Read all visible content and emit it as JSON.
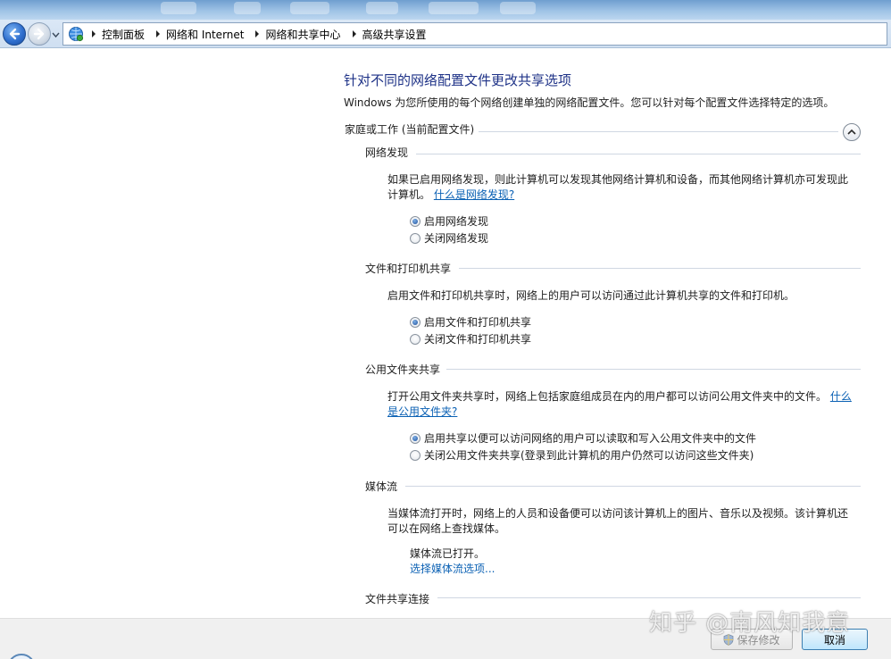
{
  "breadcrumb": [
    "控制面板",
    "网络和 Internet",
    "网络和共享中心",
    "高级共享设置"
  ],
  "page": {
    "title": "针对不同的网络配置文件更改共享选项",
    "description": "Windows 为您所使用的每个网络创建单独的网络配置文件。您可以针对每个配置文件选择特定的选项。"
  },
  "profile": {
    "label": "家庭或工作 (当前配置文件)",
    "sections": {
      "discovery": {
        "title": "网络发现",
        "desc": "如果已启用网络发现，则此计算机可以发现其他网络计算机和设备，而其他网络计算机亦可发现此计算机。",
        "link": "什么是网络发现?",
        "options": [
          "启用网络发现",
          "关闭网络发现"
        ],
        "selected": 0
      },
      "fileprint": {
        "title": "文件和打印机共享",
        "desc": "启用文件和打印机共享时，网络上的用户可以访问通过此计算机共享的文件和打印机。",
        "options": [
          "启用文件和打印机共享",
          "关闭文件和打印机共享"
        ],
        "selected": 0
      },
      "publicfolder": {
        "title": "公用文件夹共享",
        "desc": "打开公用文件夹共享时，网络上包括家庭组成员在内的用户都可以访问公用文件夹中的文件。",
        "link": "什么是公用文件夹?",
        "options": [
          "启用共享以便可以访问网络的用户可以读取和写入公用文件夹中的文件",
          "关闭公用文件夹共享(登录到此计算机的用户仍然可以访问这些文件夹)"
        ],
        "selected": 0
      },
      "media": {
        "title": "媒体流",
        "desc": "当媒体流打开时，网络上的人员和设备便可以访问该计算机上的图片、音乐以及视频。该计算机还可以在网络上查找媒体。",
        "status": "媒体流已打开。",
        "link": "选择媒体流选项..."
      },
      "connections": {
        "title": "文件共享连接"
      }
    }
  },
  "buttons": {
    "save": "保存修改",
    "cancel": "取消"
  },
  "watermark": "知乎 @南风知我意",
  "icons": {
    "back": "back-arrow-icon",
    "forward": "forward-arrow-icon",
    "address": "network-globe-icon",
    "collapse": "chevron-up-icon",
    "shield": "uac-shield-icon"
  }
}
